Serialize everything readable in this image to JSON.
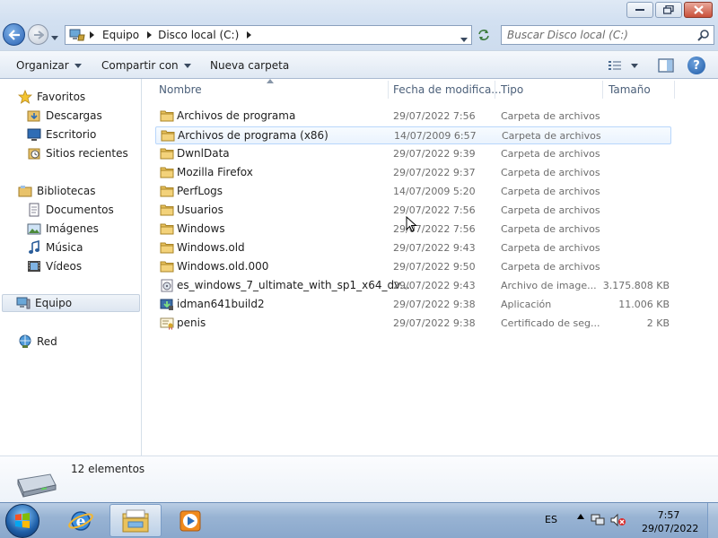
{
  "address": {
    "crumbs": [
      "Equipo",
      "Disco local (C:)"
    ]
  },
  "search": {
    "placeholder": "Buscar Disco local (C:)"
  },
  "toolbar": {
    "organize": "Organizar",
    "share": "Compartir con",
    "new_folder": "Nueva carpeta"
  },
  "nav": {
    "favorites": "Favoritos",
    "fav_items": [
      "Descargas",
      "Escritorio",
      "Sitios recientes"
    ],
    "libraries": "Bibliotecas",
    "lib_items": [
      "Documentos",
      "Imágenes",
      "Música",
      "Vídeos"
    ],
    "computer": "Equipo",
    "network": "Red"
  },
  "columns": {
    "name": "Nombre",
    "date": "Fecha de modifica...",
    "type": "Tipo",
    "size": "Tamaño"
  },
  "files": [
    {
      "name": "Archivos de programa",
      "date": "29/07/2022 7:56",
      "type": "Carpeta de archivos",
      "size": "",
      "icon": "folder-icon"
    },
    {
      "name": "Archivos de programa (x86)",
      "date": "14/07/2009 6:57",
      "type": "Carpeta de archivos",
      "size": "",
      "icon": "folder-icon"
    },
    {
      "name": "DwnlData",
      "date": "29/07/2022 9:39",
      "type": "Carpeta de archivos",
      "size": "",
      "icon": "folder-icon"
    },
    {
      "name": "Mozilla Firefox",
      "date": "29/07/2022 9:37",
      "type": "Carpeta de archivos",
      "size": "",
      "icon": "folder-icon"
    },
    {
      "name": "PerfLogs",
      "date": "14/07/2009 5:20",
      "type": "Carpeta de archivos",
      "size": "",
      "icon": "folder-icon"
    },
    {
      "name": "Usuarios",
      "date": "29/07/2022 7:56",
      "type": "Carpeta de archivos",
      "size": "",
      "icon": "folder-icon"
    },
    {
      "name": "Windows",
      "date": "29/07/2022 7:56",
      "type": "Carpeta de archivos",
      "size": "",
      "icon": "folder-icon"
    },
    {
      "name": "Windows.old",
      "date": "29/07/2022 9:43",
      "type": "Carpeta de archivos",
      "size": "",
      "icon": "folder-icon"
    },
    {
      "name": "Windows.old.000",
      "date": "29/07/2022 9:50",
      "type": "Carpeta de archivos",
      "size": "",
      "icon": "folder-icon"
    },
    {
      "name": "es_windows_7_ultimate_with_sp1_x64_dv...",
      "date": "29/07/2022 9:43",
      "type": "Archivo de image...",
      "size": "3.175.808 KB",
      "icon": "disc-image-icon"
    },
    {
      "name": "idman641build2",
      "date": "29/07/2022 9:38",
      "type": "Aplicación",
      "size": "11.006 KB",
      "icon": "installer-icon"
    },
    {
      "name": "penis",
      "date": "29/07/2022 9:38",
      "type": "Certificado de seg...",
      "size": "2 KB",
      "icon": "certificate-icon"
    }
  ],
  "details": {
    "count": "12 elementos"
  },
  "taskbar": {
    "language": "ES",
    "time": "7:57",
    "date": "29/07/2022"
  }
}
